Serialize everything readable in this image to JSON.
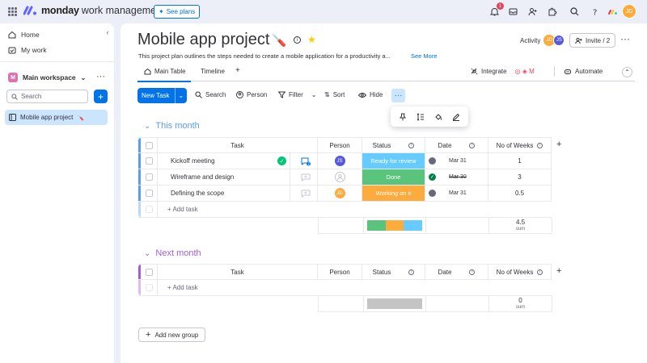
{
  "topbar": {
    "brand": "monday",
    "brand_sub": "work management",
    "see_plans": "See plans",
    "notif_count": "1",
    "user_initials": "JD"
  },
  "sidebar": {
    "home": "Home",
    "my_work": "My work",
    "workspace_badge": "M",
    "workspace": "Main workspace",
    "search_placeholder": "Search",
    "board": "Mobile app project"
  },
  "header": {
    "title": "Mobile app project",
    "title_emoji": "🪛",
    "description": "This project plan outlines the steps needed to create a mobile application for a productivity a...",
    "see_more": "See More",
    "activity": "Activity",
    "activity_avatars": [
      "JD",
      "JS"
    ],
    "invite": "Invite / 2"
  },
  "tabs": {
    "main_table": "Main Table",
    "timeline": "Timeline",
    "integrate": "Integrate",
    "automate": "Automate"
  },
  "toolbar": {
    "new_task": "New Task",
    "search": "Search",
    "person": "Person",
    "filter": "Filter",
    "sort": "Sort",
    "hide": "Hide"
  },
  "columns": {
    "task": "Task",
    "person": "Person",
    "status": "Status",
    "date": "Date",
    "weeks": "No of Weeks"
  },
  "groups": [
    {
      "title": "This month",
      "color": "#579bfc",
      "rows": [
        {
          "task": "Kickoff meeting",
          "person": "JS",
          "person_color": "#5559df",
          "status": "Ready for review",
          "status_color": "#66ccff",
          "date": "Mar 31",
          "weeks": "1"
        },
        {
          "task": "Wireframe and design",
          "person": "",
          "person_color": "",
          "status": "Done",
          "status_color": "#5ac47d",
          "date": "Mar 30",
          "weeks": "3"
        },
        {
          "task": "Defining the scope",
          "person": "JD",
          "person_color": "#fdab3d",
          "status": "Working on it",
          "status_color": "#fdab3d",
          "date": "Mar 31",
          "weeks": "0.5"
        }
      ],
      "add_task": "+ Add task",
      "sum_value": "4.5",
      "sum_label": "sum"
    },
    {
      "title": "Next month",
      "color": "#a25ddc",
      "rows": [],
      "add_task": "+ Add task",
      "sum_value": "0",
      "sum_label": "sum"
    }
  ],
  "add_group": "Add new group"
}
